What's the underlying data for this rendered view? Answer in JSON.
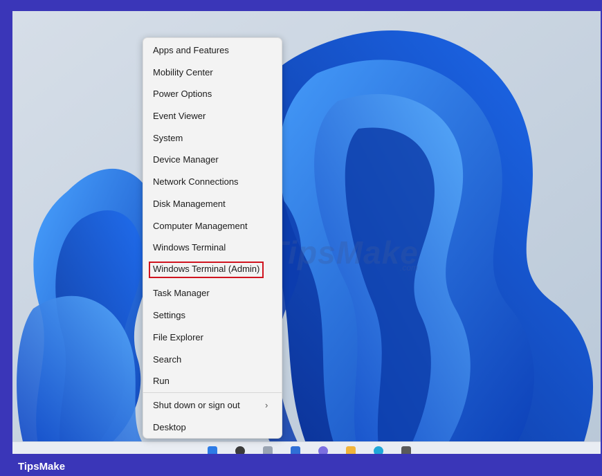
{
  "context_menu": {
    "items": [
      {
        "label": "Apps and Features"
      },
      {
        "label": "Mobility Center"
      },
      {
        "label": "Power Options"
      },
      {
        "label": "Event Viewer"
      },
      {
        "label": "System"
      },
      {
        "label": "Device Manager"
      },
      {
        "label": "Network Connections"
      },
      {
        "label": "Disk Management"
      },
      {
        "label": "Computer Management"
      },
      {
        "label": "Windows Terminal"
      },
      {
        "label": "Windows Terminal (Admin)",
        "highlighted": true
      },
      {
        "label": "Task Manager"
      },
      {
        "label": "Settings"
      },
      {
        "label": "File Explorer"
      },
      {
        "label": "Search"
      },
      {
        "label": "Run"
      },
      {
        "label": "Shut down or sign out",
        "submenu_icon": "chevron-right-icon"
      },
      {
        "label": "Desktop"
      }
    ],
    "chevron_glyph": "›"
  },
  "watermark": {
    "text": "TipsMake",
    "suffix": ".com"
  },
  "footer": {
    "brand": "TipsMake"
  },
  "colors": {
    "frame": "#3a36b8",
    "highlight_border": "#d0141f",
    "wallpaper_blue": "#1e63e0"
  }
}
